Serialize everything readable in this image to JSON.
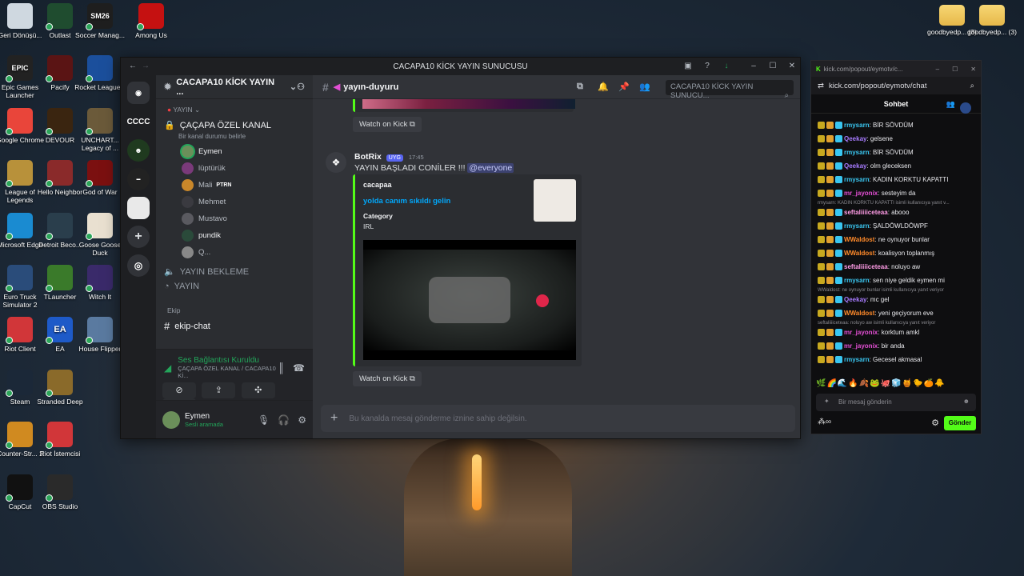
{
  "desktop": {
    "left_icons": [
      {
        "label": "Geri Dönüşü...",
        "color": "#cfd8e0"
      },
      {
        "label": "Outlast",
        "color": "#1f4c2f"
      },
      {
        "label": "Soccer Manag...",
        "color": "#1e1e1e",
        "glyph": "SM26"
      },
      {
        "label": "Among Us",
        "color": "#c51111"
      },
      {
        "label": "Epic Games Launcher",
        "color": "#222222",
        "glyph": "EPIC"
      },
      {
        "label": "Pacify",
        "color": "#5a1414"
      },
      {
        "label": "Rocket League®",
        "color": "#1b4f9c"
      },
      {
        "label": "Google Chrome",
        "color": "#e9453a"
      },
      {
        "label": "DEVOUR",
        "color": "#3a2510"
      },
      {
        "label": "UNCHART... Legacy of ...",
        "color": "#6b5a3a"
      },
      {
        "label": "League of Legends",
        "color": "#b8913a"
      },
      {
        "label": "Hello Neighbor",
        "color": "#8a2a2a"
      },
      {
        "label": "God of War",
        "color": "#7b1010"
      },
      {
        "label": "Microsoft Edge",
        "color": "#1a8bd1"
      },
      {
        "label": "Detroit Beco...",
        "color": "#2a3e4c"
      },
      {
        "label": "Goose Goose Duck",
        "color": "#e9e0d0"
      },
      {
        "label": "Euro Truck Simulator 2",
        "color": "#2a4c7a"
      },
      {
        "label": "TLauncher",
        "color": "#3a7a2a"
      },
      {
        "label": "Witch It",
        "color": "#3a2a6a"
      },
      {
        "label": "Riot Client",
        "color": "#d13639"
      },
      {
        "label": "EA",
        "color": "#1e5ac8",
        "glyph": "EA"
      },
      {
        "label": "House Flipper",
        "color": "#5a7aa0"
      },
      {
        "label": "Steam",
        "color": "#1b2838"
      },
      {
        "label": "Stranded Deep",
        "color": "#8a6a2a"
      },
      {
        "label": "Counter-Str... 2",
        "color": "#d08a20"
      },
      {
        "label": "Riot İstemcisi",
        "color": "#d13639"
      },
      {
        "label": "CapCut",
        "color": "#111111"
      },
      {
        "label": "OBS Studio",
        "color": "#2a2a2a"
      }
    ],
    "right_icons": [
      {
        "label": "goodbyedp... (3)"
      },
      {
        "label": "goodbyedp... (3)"
      }
    ]
  },
  "discord": {
    "window_title": "CACAPA10 KİCK YAYIN SUNUCUSU",
    "server_name": "CACAPA10 KİCK YAYIN ...",
    "guilds": [
      "CCCC"
    ],
    "category_yayin": "YAYIN",
    "voice_channel": "ÇAÇAPA ÖZEL KANAL",
    "voice_status_hint": "Bir kanal durumu belirle",
    "voice_users": [
      {
        "name": "Eymen",
        "color": "#6b8f5a"
      },
      {
        "name": "lüptürük",
        "color": "#7a3a7a"
      },
      {
        "name": "Mali",
        "color": "#c9872a",
        "badge": "PTRN"
      },
      {
        "name": "Mehmet",
        "color": "#3a3a40"
      },
      {
        "name": "Mustavo",
        "color": "#5a5a60"
      },
      {
        "name": "pundik",
        "color": "#2a4a3a"
      },
      {
        "name": "Q...",
        "color": "#888888"
      }
    ],
    "channels": [
      "YAYIN BEKLEME",
      "YAYIN"
    ],
    "category_ekip": "Ekip",
    "text_channel": "ekip-chat",
    "connection_title": "Ses Bağlantısı Kuruldu",
    "connection_sub": "ÇAÇAPA ÖZEL KANAL / CACAPA10 Kİ...",
    "user_name": "Eymen",
    "user_status": "Sesli aramada",
    "channel_header": "yayın-duyuru",
    "search_placeholder": "CACAPA10 KİCK YAYIN SUNUCU...",
    "watch_label": "Watch on Kick",
    "message": {
      "author": "BotRix",
      "tag": "UYG",
      "time": "17:45",
      "text": "YAYIN BAŞLADI CONİLER !!!",
      "mention": "@everyone",
      "embed_author": "cacapaa",
      "embed_title": "yolda canım sıkıldı gelin",
      "field_name": "Category",
      "field_value": "IRL"
    },
    "composer_placeholder": "Bu kanalda mesaj gönderme iznine sahip değilsin.",
    "accent": "#53fc18"
  },
  "kick": {
    "tab_url": "kick.com/popout/eymotv/c...",
    "address": "kick.com/popout/eymotv/chat",
    "header": "Sohbet",
    "messages": [
      {
        "user": "rmysarn",
        "color": "#3ac6f0",
        "text": "BİR SÖVDÜM"
      },
      {
        "user": "Qeekay",
        "color": "#a77bff",
        "text": "gelsene"
      },
      {
        "user": "rmysarn",
        "color": "#3ac6f0",
        "text": "BİR SÖVDÜM"
      },
      {
        "user": "Qeekay",
        "color": "#a77bff",
        "text": "olm gleceksen"
      },
      {
        "user": "rmysarn",
        "color": "#3ac6f0",
        "text": "KADIN KORKTU KAPATTI"
      },
      {
        "user": "mr_jayonix",
        "color": "#e34fd4",
        "text": "sesteyim da"
      },
      {
        "reply": "rmysarn: KADIN KORKTU KAPATTI isimli kullanıcıya yanıt v..."
      },
      {
        "user": "seftaliiiiceteaa",
        "color": "#ff9ce6",
        "text": "abooo"
      },
      {
        "user": "rmysarn",
        "color": "#3ac6f0",
        "text": "ŞALDÖWLDÖWPF"
      },
      {
        "user": "WWaldost",
        "color": "#ff8a2a",
        "text": "ne oynuyor bunlar"
      },
      {
        "user": "WWaldost",
        "color": "#ff8a2a",
        "text": "koalisyon toplanmış"
      },
      {
        "user": "seftaliiiiceteaa",
        "color": "#ff9ce6",
        "text": "noluyo aw"
      },
      {
        "user": "rmysarn",
        "color": "#3ac6f0",
        "text": "sen niye geldik eymen mi"
      },
      {
        "reply": "WWaldost: ne oynuyor bunlar isimli kullanıcıya yanıt veriyor"
      },
      {
        "user": "Qeekay",
        "color": "#a77bff",
        "text": "mc gel"
      },
      {
        "user": "WWaldost",
        "color": "#ff8a2a",
        "text": "yeni geçiyorum eve"
      },
      {
        "reply": "seftaliiiiceteaa: noluyo aw isimli kullanıcıya yanıt veriyor"
      },
      {
        "user": "mr_jayonix",
        "color": "#e34fd4",
        "text": "korktum amkl"
      },
      {
        "user": "mr_jayonix",
        "color": "#e34fd4",
        "text": "bir anda"
      },
      {
        "user": "rmysarn",
        "color": "#3ac6f0",
        "text": "Gecesel akmasal"
      }
    ],
    "input_placeholder": "Bir mesaj gönderin",
    "send_label": "Gönder"
  }
}
